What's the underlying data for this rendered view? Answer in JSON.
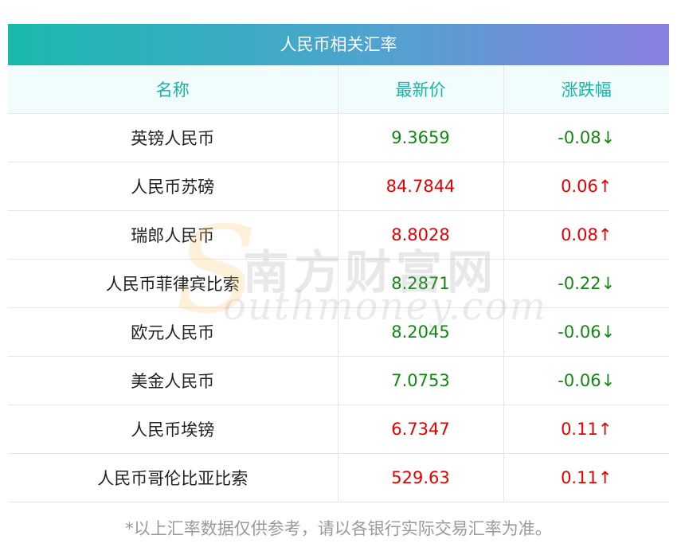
{
  "title": "人民币相关汇率",
  "headers": {
    "name": "名称",
    "price": "最新价",
    "change": "涨跌幅"
  },
  "rows": [
    {
      "name": "英镑人民币",
      "price": "9.3659",
      "change": "-0.08↓",
      "dir": "down"
    },
    {
      "name": "人民币苏磅",
      "price": "84.7844",
      "change": "0.06↑",
      "dir": "up"
    },
    {
      "name": "瑞郎人民币",
      "price": "8.8028",
      "change": "0.08↑",
      "dir": "up"
    },
    {
      "name": "人民币菲律宾比索",
      "price": "8.2871",
      "change": "-0.22↓",
      "dir": "down"
    },
    {
      "name": "欧元人民币",
      "price": "8.2045",
      "change": "-0.06↓",
      "dir": "down"
    },
    {
      "name": "美金人民币",
      "price": "7.0753",
      "change": "-0.06↓",
      "dir": "down"
    },
    {
      "name": "人民币埃镑",
      "price": "6.7347",
      "change": "0.11↑",
      "dir": "up"
    },
    {
      "name": "人民币哥伦比亚比索",
      "price": "529.63",
      "change": "0.11↑",
      "dir": "up"
    }
  ],
  "footnote": "*以上汇率数据仅供参考，请以各银行实际交易汇率为准。",
  "watermark": {
    "cn": "南方财富网",
    "en": "outhmoney.com",
    "logo": "S"
  },
  "colors": {
    "up": "#e60000",
    "down": "#118811",
    "header_text": "#19b3a8"
  }
}
